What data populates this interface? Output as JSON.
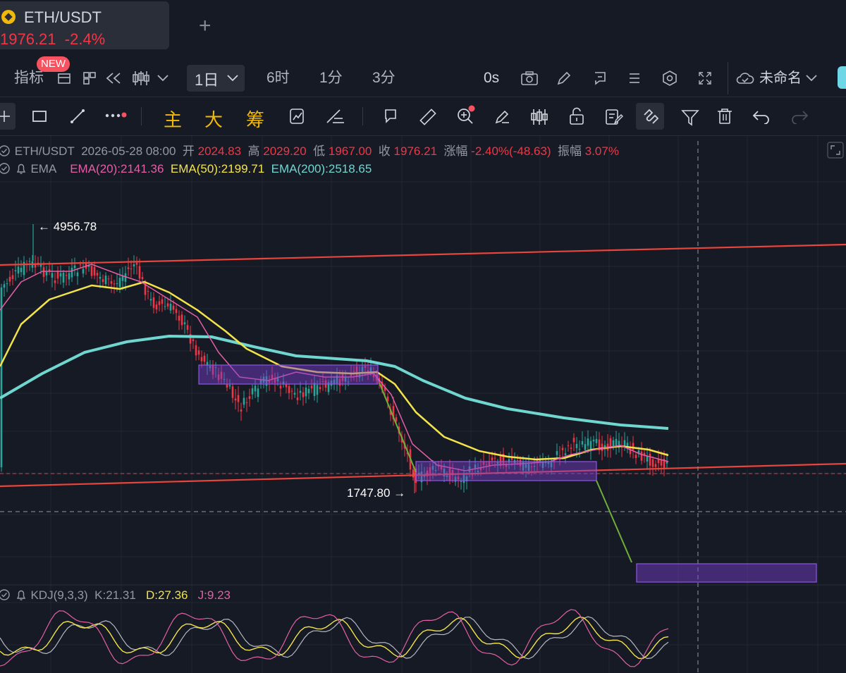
{
  "tab": {
    "symbol": "ETH/USDT",
    "price": "1976.21",
    "change": "-2.4%",
    "add_symbol": "+"
  },
  "toolbar": {
    "indicators_label": "指标",
    "new_badge": "NEW",
    "timeframe_selected": "1日",
    "timeframes": [
      "6时",
      "1分",
      "3分"
    ],
    "timer": "0s",
    "layout_name": "未命名",
    "quick_buttons": [
      "主",
      "大",
      "筹"
    ]
  },
  "ohlc": {
    "symbol": "ETH/USDT",
    "datetime": "2026-05-28 08:00",
    "open_label": "开",
    "open": "2024.83",
    "high_label": "高",
    "high": "2029.20",
    "low_label": "低",
    "low": "1967.00",
    "close_label": "收",
    "close": "1976.21",
    "change_label": "涨幅",
    "change": "-2.40%(-48.63)",
    "amplitude_label": "振幅",
    "amplitude": "3.07%"
  },
  "ema": {
    "name": "EMA",
    "ema20": "EMA(20):2141.36",
    "ema50": "EMA(50):2199.71",
    "ema200": "EMA(200):2518.65"
  },
  "annotations": {
    "high": "← 4956.78",
    "low": "1747.80 →"
  },
  "kdj": {
    "name": "KDJ(9,3,3)",
    "k": "K:21.31",
    "d": "D:27.36",
    "j": "J:9.23"
  },
  "colors": {
    "background": "#161a25",
    "up": "#26a69a",
    "down": "#f23645",
    "ema20": "#e45fa5",
    "ema50": "#f3e34a",
    "ema200": "#6fd6d0",
    "trendline": "#e8453c",
    "zone": "#7b3fd1",
    "projection": "#6fae3c"
  },
  "chart_data": {
    "type": "candlestick",
    "symbol": "ETH/USDT",
    "interval": "1日",
    "marked_high": 4956.78,
    "marked_low": 1747.8,
    "last_close": 1976.21,
    "ema": [
      {
        "name": "EMA(20)",
        "value": 2141.36
      },
      {
        "name": "EMA(50)",
        "value": 2199.71
      },
      {
        "name": "EMA(200)",
        "value": 2518.65
      }
    ],
    "kdj": {
      "K": 21.31,
      "D": 27.36,
      "J": 9.23
    }
  }
}
